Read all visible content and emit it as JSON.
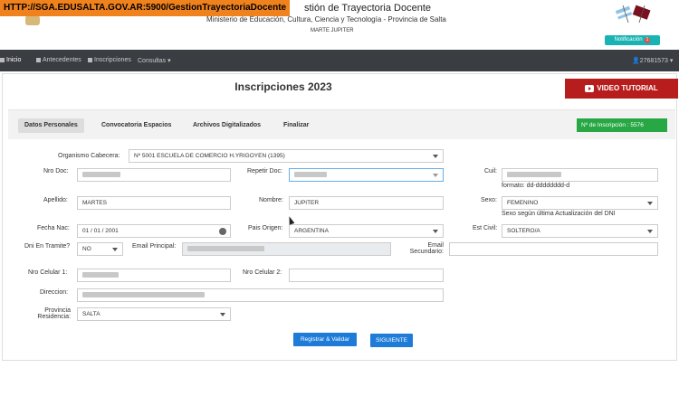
{
  "url_banner": "HTTP://SGA.EDUSALTA.GOV.AR:5900/GestionTrayectoriaDocente",
  "header": {
    "app_title": "stión de Trayectoria Docente",
    "ministry": "Ministerio de Educación, Cultura, Ciencia y Tecnología - Provincia de Salta",
    "username": "MARTE JUPITER",
    "notification_label": "Notificación",
    "notification_count": "1"
  },
  "navbar": {
    "items": [
      "Inicio",
      "Antecedentes",
      "Inscripciones",
      "Consultas"
    ],
    "user_id": "27681573"
  },
  "page": {
    "heading": "Inscripciones 2023",
    "video_button": "VIDEO TUTORIAL",
    "tabs": [
      "Datos Personales",
      "Convocatoria Espacios",
      "Archivos Digitalizados",
      "Finalizar"
    ],
    "inscription_badge": "Nº de Inscripción : 5576"
  },
  "form": {
    "organismo_label": "Organismo Cabecera:",
    "organismo_value": "Nº 5001 ESCUELA DE COMERCIO H.YRIGOYEN (1395)",
    "nro_doc_label": "Nro Doc:",
    "repetir_doc_label": "Repetir Doc:",
    "cuil_label": "Cuil:",
    "cuil_format": "formato: dd-dddddddd-d",
    "apellido_label": "Apellido:",
    "apellido_value": "MARTES",
    "nombre_label": "Nombre:",
    "nombre_value": "JUPITER",
    "sexo_label": "Sexo:",
    "sexo_value": "FEMENINO",
    "sexo_note": "Sexo según última Actualización del DNI",
    "fecha_nac_label": "Fecha Nac:",
    "fecha_nac_value": "01 / 01 / 2001",
    "pais_origen_label": "Pais Origen:",
    "pais_origen_value": "ARGENTINA",
    "est_civil_label": "Est Civil:",
    "est_civil_value": "SOLTERO/A",
    "dni_tramite_label": "Dni En Tramite?",
    "dni_tramite_value": "NO",
    "email_principal_label": "Email Principal:",
    "email_secundario_label_1": "Email",
    "email_secundario_label_2": "Secundario:",
    "nro_celular1_label": "Nro Celular 1:",
    "nro_celular2_label": "Nro Celular 2:",
    "direccion_label": "Direccion:",
    "provincia_label_1": "Provincia",
    "provincia_label_2": "Residencia:",
    "provincia_value": "SALTA",
    "registrar_button": "Registrar & Validar",
    "siguiente_button": "SIGUIENTE"
  },
  "colors": {
    "banner": "#f0821e",
    "navbar": "#3a3d42",
    "video_button": "#b81d1d",
    "inscription_badge": "#28a745",
    "primary_button": "#1e7bd8",
    "notification_button": "#1ab3b3"
  }
}
